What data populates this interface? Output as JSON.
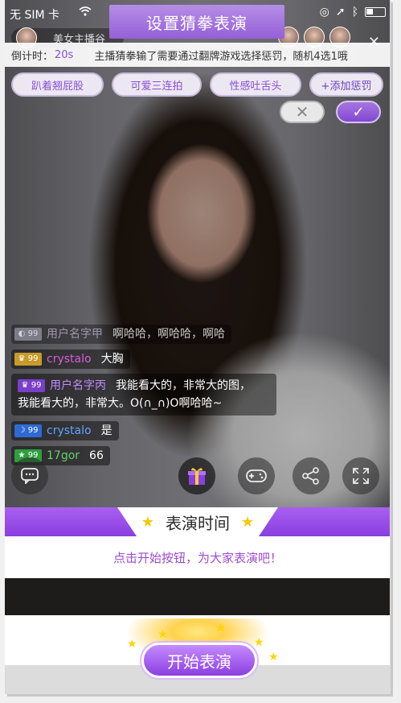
{
  "status_bar": {
    "carrier": "无 SIM 卡",
    "wifi_icon": "wifi-icon",
    "right_icons": [
      "orientation-lock-icon",
      "location-icon",
      "bluetooth-icon",
      "battery-icon"
    ]
  },
  "header": {
    "title": "设置猜拳表演",
    "anchor_name": "美女主播谷"
  },
  "countdown": {
    "label": "倒计时：",
    "value": "20s",
    "message": "主播猜拳输了需要通过翻牌游戏选择惩罚，随机4选1哦"
  },
  "punishments": {
    "items": [
      "趴着翘屁股",
      "可爱三连拍",
      "性感吐舌头"
    ],
    "add_label": "+添加惩罚"
  },
  "actions": {
    "reject_symbol": "✕",
    "confirm_symbol": "✓"
  },
  "chat": [
    {
      "level": "99",
      "badge_color": "gray",
      "user": "用户名字甲",
      "text": "啊哈哈，啊哈哈，啊哈"
    },
    {
      "level": "99",
      "badge_color": "gold",
      "user": "crystalo",
      "text": "大胸"
    },
    {
      "level": "99",
      "badge_color": "purple",
      "user": "用户名字丙",
      "text": "我能看大的，非常大的图，",
      "text2": "我能看大的，非常大。O(∩_∩)O啊哈哈~"
    },
    {
      "level": "99",
      "badge_color": "blue",
      "user": "crystalo",
      "text": "是"
    },
    {
      "level": "99",
      "badge_color": "green",
      "user": "17gor",
      "text": "66"
    }
  ],
  "toolbar": {
    "icons": [
      "chat-icon",
      "gift-icon",
      "gamepad-icon",
      "share-icon",
      "fullscreen-icon"
    ]
  },
  "performance": {
    "title": "表演时间",
    "subtitle": "点击开始按钮，为大家表演吧！",
    "start_label": "开始表演"
  },
  "colors": {
    "accent": "#8a4fd6",
    "star": "#f5c800",
    "subtitle": "#a04ad0"
  }
}
